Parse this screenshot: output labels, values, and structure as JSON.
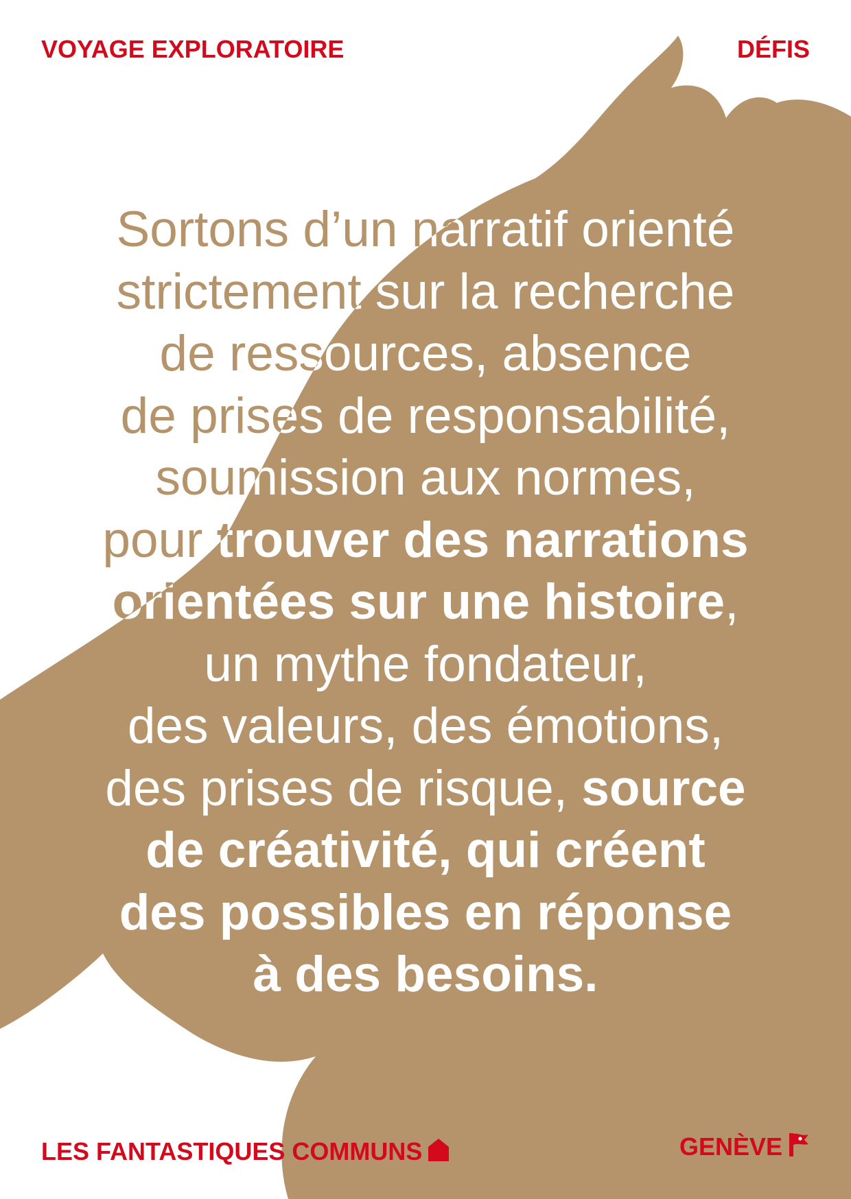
{
  "header": {
    "left_label": "VOYAGE EXPLORATOIRE",
    "right_label": "DÉFIS"
  },
  "footer": {
    "left_label": "LES FANTASTIQUES COMMUNS",
    "left_icon": "house-icon",
    "right_label": "GENÈVE",
    "right_icon": "flag-icon"
  },
  "colors": {
    "accent_red": "#d20a1c",
    "tan": "#b5946b",
    "background": "#ffffff"
  },
  "body": {
    "lines": [
      [
        {
          "t": "Sortons d’un narratif orienté",
          "b": false
        }
      ],
      [
        {
          "t": "strictement sur la recherche",
          "b": false
        }
      ],
      [
        {
          "t": "de ressources, absence",
          "b": false
        }
      ],
      [
        {
          "t": "de prises de responsabilité,",
          "b": false
        }
      ],
      [
        {
          "t": "soumission aux normes,",
          "b": false
        }
      ],
      [
        {
          "t": "pour ",
          "b": false
        },
        {
          "t": "trouver des narrations",
          "b": true
        }
      ],
      [
        {
          "t": "orientées sur une histoire",
          "b": true
        },
        {
          "t": ",",
          "b": false
        }
      ],
      [
        {
          "t": "un mythe fondateur,",
          "b": false
        }
      ],
      [
        {
          "t": "des valeurs, des émotions,",
          "b": false
        }
      ],
      [
        {
          "t": "des prises de risque, ",
          "b": false
        },
        {
          "t": "source",
          "b": true
        }
      ],
      [
        {
          "t": "de créativité, qui créent",
          "b": true
        }
      ],
      [
        {
          "t": "des possibles en réponse",
          "b": true
        }
      ],
      [
        {
          "t": "à des besoins.",
          "b": true
        }
      ]
    ]
  }
}
